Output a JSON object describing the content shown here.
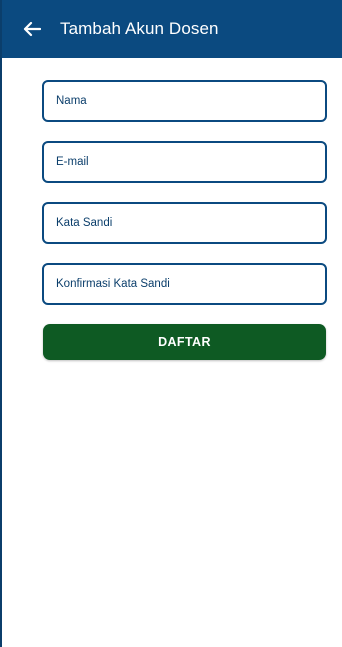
{
  "appbar": {
    "title": "Tambah Akun Dosen",
    "back_icon": "arrow-left-icon"
  },
  "form": {
    "fields": [
      {
        "placeholder": "Nama",
        "value": ""
      },
      {
        "placeholder": "E-mail",
        "value": ""
      },
      {
        "placeholder": "Kata Sandi",
        "value": ""
      },
      {
        "placeholder": "Konfirmasi Kata Sandi",
        "value": ""
      }
    ],
    "submit_label": "DAFTAR"
  },
  "colors": {
    "appbar": "#0b4a80",
    "field_border": "#0b4a80",
    "submit": "#0e5a23",
    "background": "#ffffff"
  }
}
